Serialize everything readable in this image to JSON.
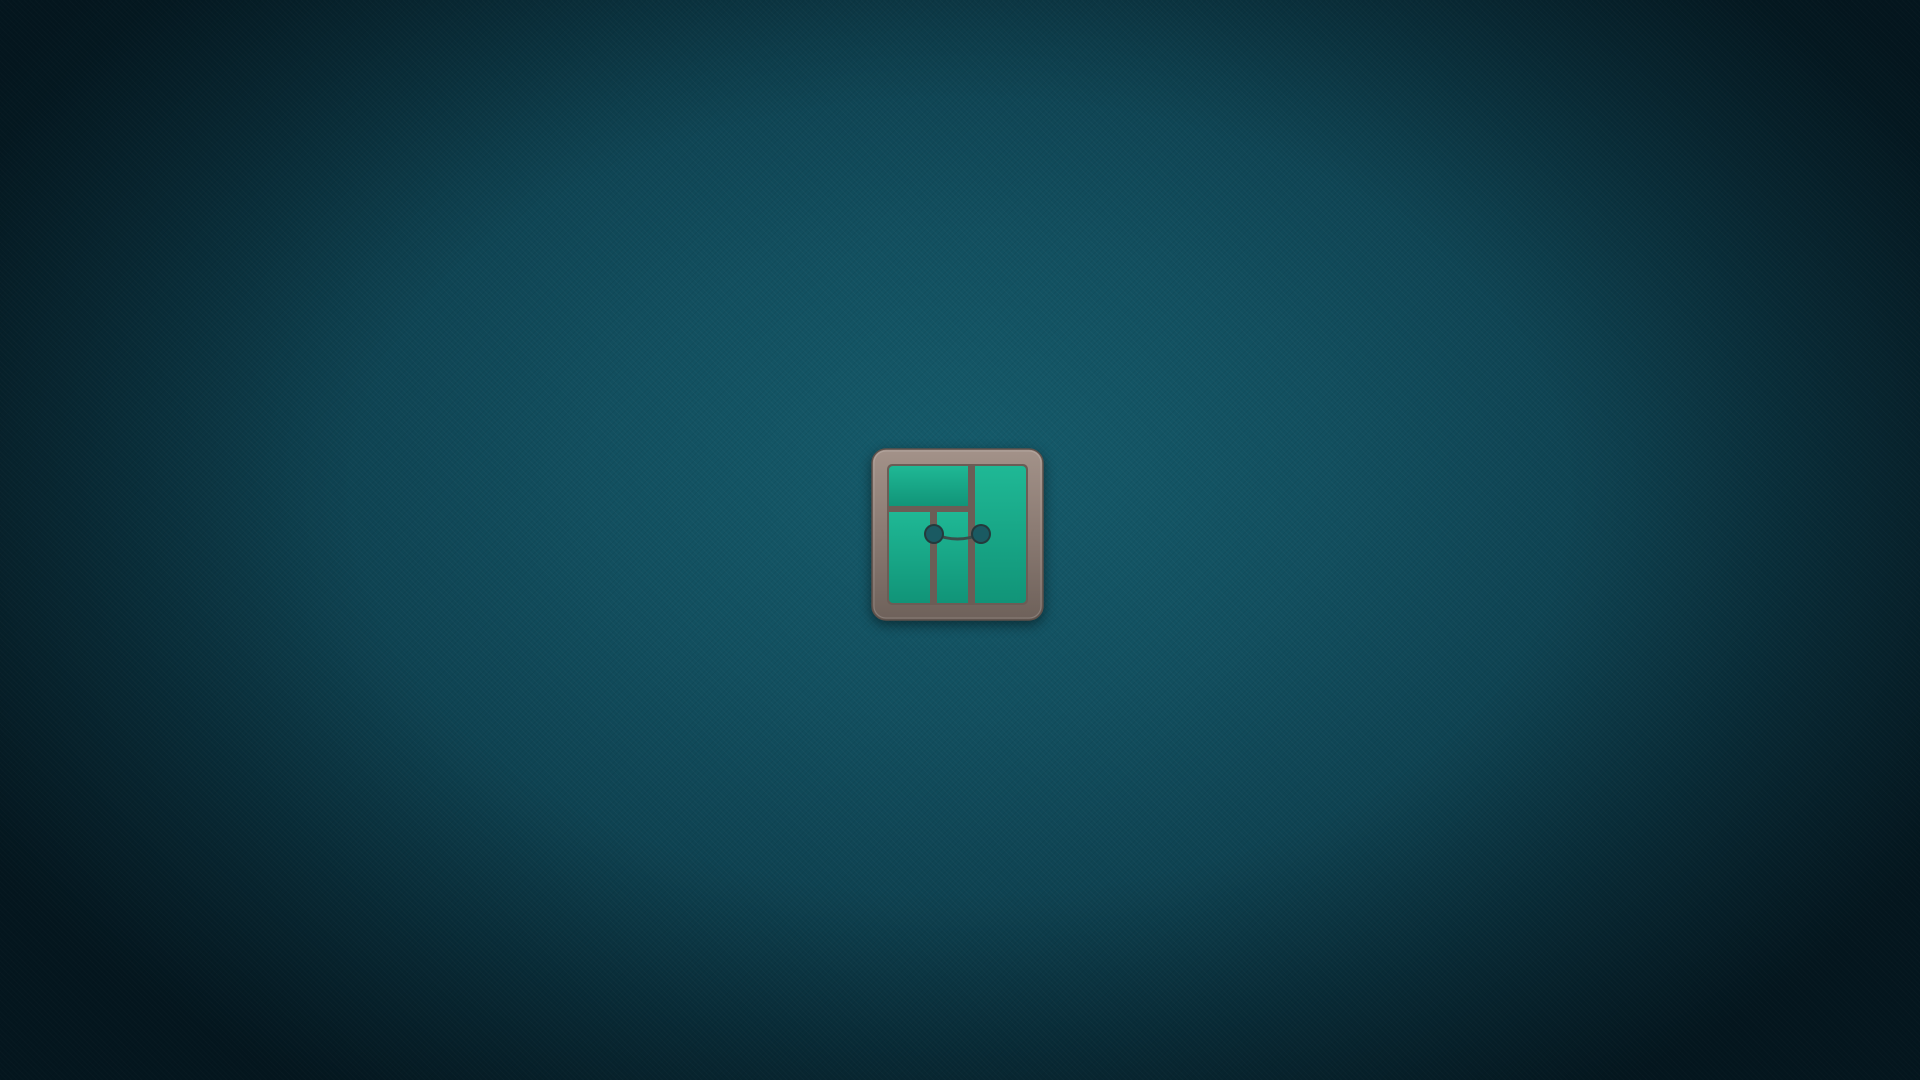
{
  "desktop": {
    "wallpaper": {
      "center_color": "#155b6b",
      "edge_color": "#062330"
    },
    "logo": {
      "icon": "manjaro-logo-icon",
      "frame_color": "#8a7a72",
      "tile_color": "#14a383",
      "tile_highlight": "#1fb895"
    }
  }
}
